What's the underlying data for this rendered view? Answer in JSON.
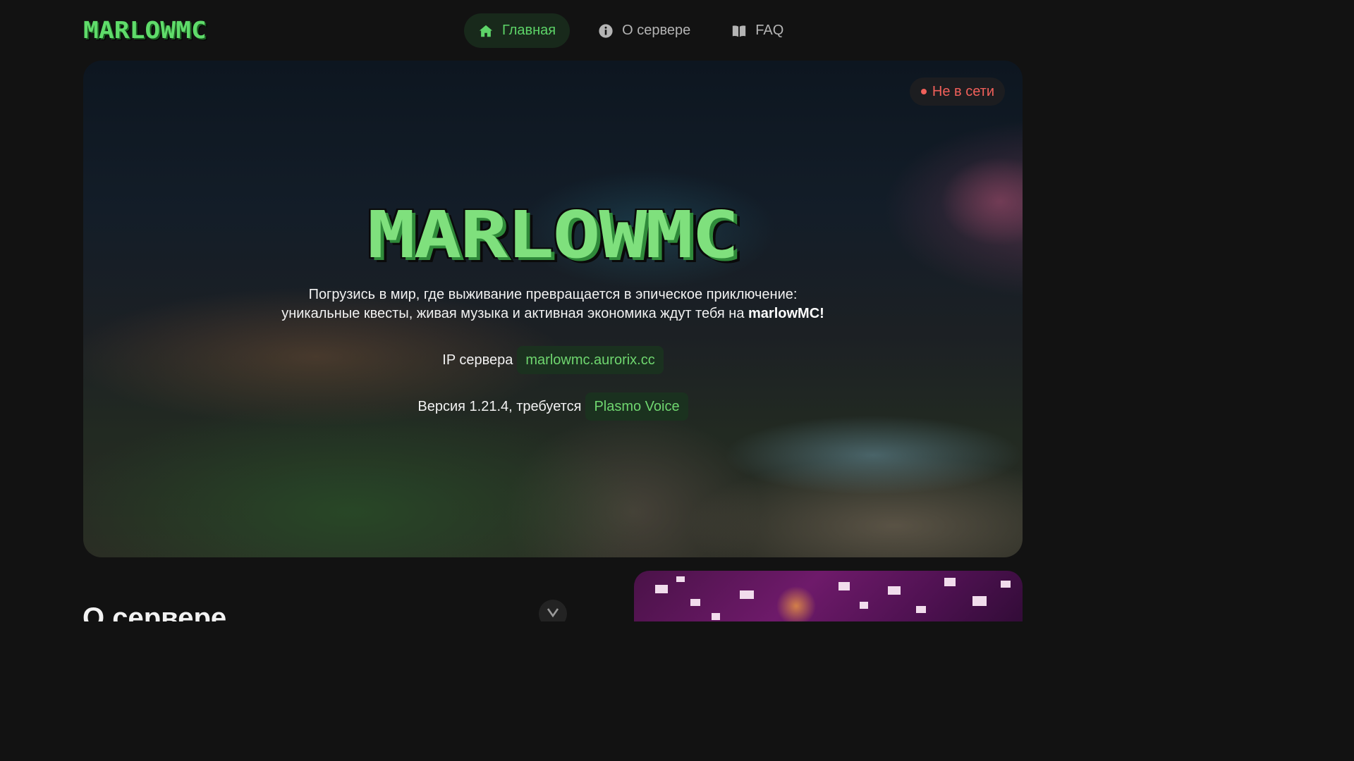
{
  "header": {
    "logo_text": "MARLOWMC",
    "nav": [
      {
        "label": "Главная",
        "icon": "home-icon",
        "active": true
      },
      {
        "label": "О сервере",
        "icon": "info-icon",
        "active": false
      },
      {
        "label": "FAQ",
        "icon": "book-icon",
        "active": false
      }
    ]
  },
  "hero": {
    "status": "Не в сети",
    "logo_text": "MARLOWMC",
    "description_line1": "Погрузись в мир, где выживание превращается в эпическое приключение:",
    "description_line2": "уникальные квесты, живая музыка и активная экономика ждут тебя на",
    "description_brand": "marlowMC!",
    "ip_label": "IP сервера",
    "ip_value": "marlowmc.aurorix.cc",
    "version_label": "Версия 1.21.4, требуется",
    "version_mod": "Plasmo Voice"
  },
  "about": {
    "title": "О сервере"
  },
  "colors": {
    "accent": "#5dd468",
    "offline": "#f0605a",
    "background": "#121212"
  }
}
